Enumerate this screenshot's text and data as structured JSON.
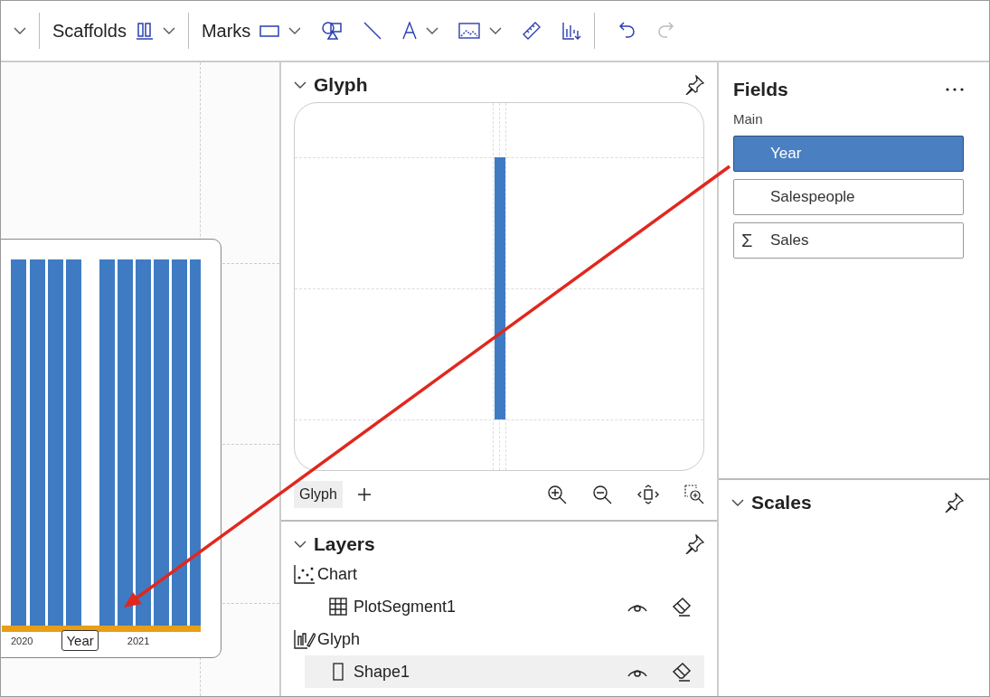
{
  "toolbar": {
    "scaffolds_label": "Scaffolds",
    "marks_label": "Marks",
    "undo": {
      "disabled": false
    },
    "redo": {
      "disabled": true
    }
  },
  "canvas": {
    "axis_labels": [
      "2020",
      "2021"
    ],
    "axis_title": "Year"
  },
  "glyph_panel": {
    "title": "Glyph",
    "tabs": [
      {
        "label": "Glyph",
        "selected": true
      }
    ]
  },
  "layers": {
    "title": "Layers",
    "items": [
      {
        "label": "Chart",
        "kind": "chart",
        "children": [
          {
            "label": "PlotSegment1",
            "kind": "plot-segment",
            "selected": false
          }
        ]
      },
      {
        "label": "Glyph",
        "kind": "glyph",
        "children": [
          {
            "label": "Shape1",
            "kind": "shape",
            "selected": true
          }
        ]
      }
    ]
  },
  "fields": {
    "title": "Fields",
    "group": "Main",
    "items": [
      {
        "label": "Year",
        "kind": "categorical",
        "selected": true
      },
      {
        "label": "Salespeople",
        "kind": "categorical",
        "selected": false
      },
      {
        "label": "Sales",
        "kind": "numeric",
        "symbol": "Σ",
        "selected": false
      }
    ]
  },
  "scales": {
    "title": "Scales"
  }
}
